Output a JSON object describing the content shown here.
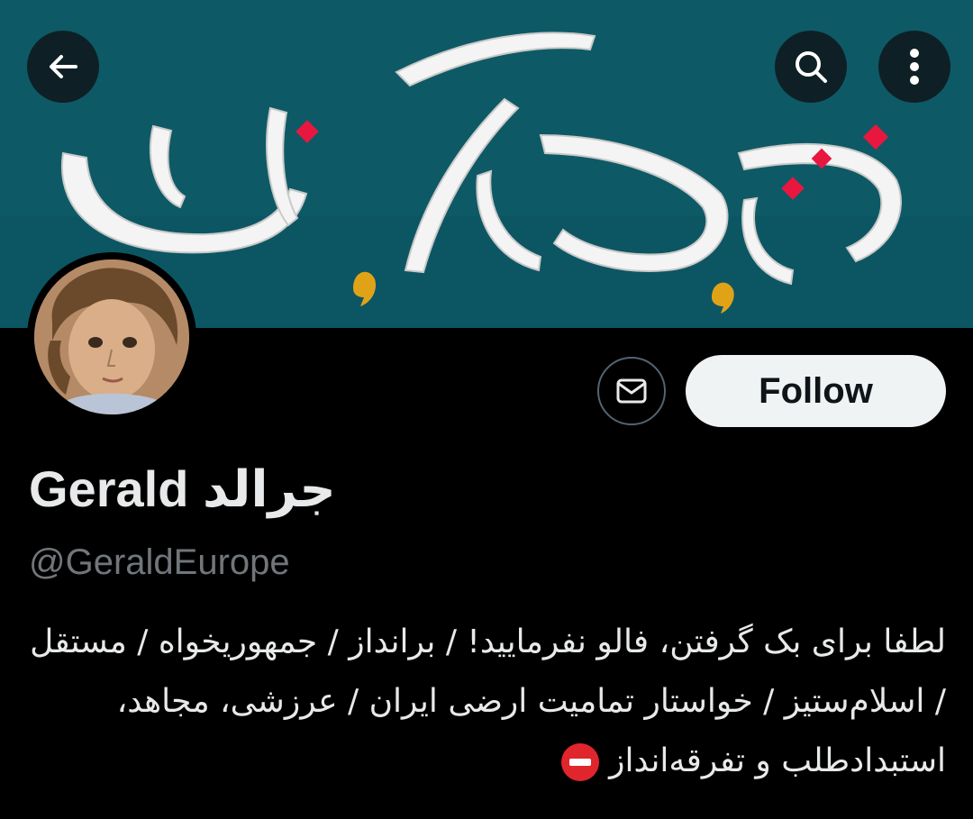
{
  "banner": {
    "slogan_text": "زن زندگی آزادی",
    "background_color": "#0d5c68",
    "accent_colors": [
      "#f2f2f2",
      "#e8173f",
      "#e0a317"
    ]
  },
  "top_bar": {
    "back_icon": "arrow-left-icon",
    "search_icon": "search-icon",
    "more_icon": "more-vertical-icon"
  },
  "profile": {
    "display_name": "Gerald جرالد",
    "handle": "@GeraldEurope",
    "follow_label": "Follow",
    "message_icon": "mail-icon",
    "bio": "لطفا برای بک گرفتن، فالو نفرمایید! / برانداز / جمهوریخواه / مستقل / اسلام‌ستیز / خواستار تمامیت ارضی ایران / عرزشی، مجاهد، استبدادطلب و تفرقه‌انداز",
    "bio_emoji": "no-entry-icon"
  }
}
